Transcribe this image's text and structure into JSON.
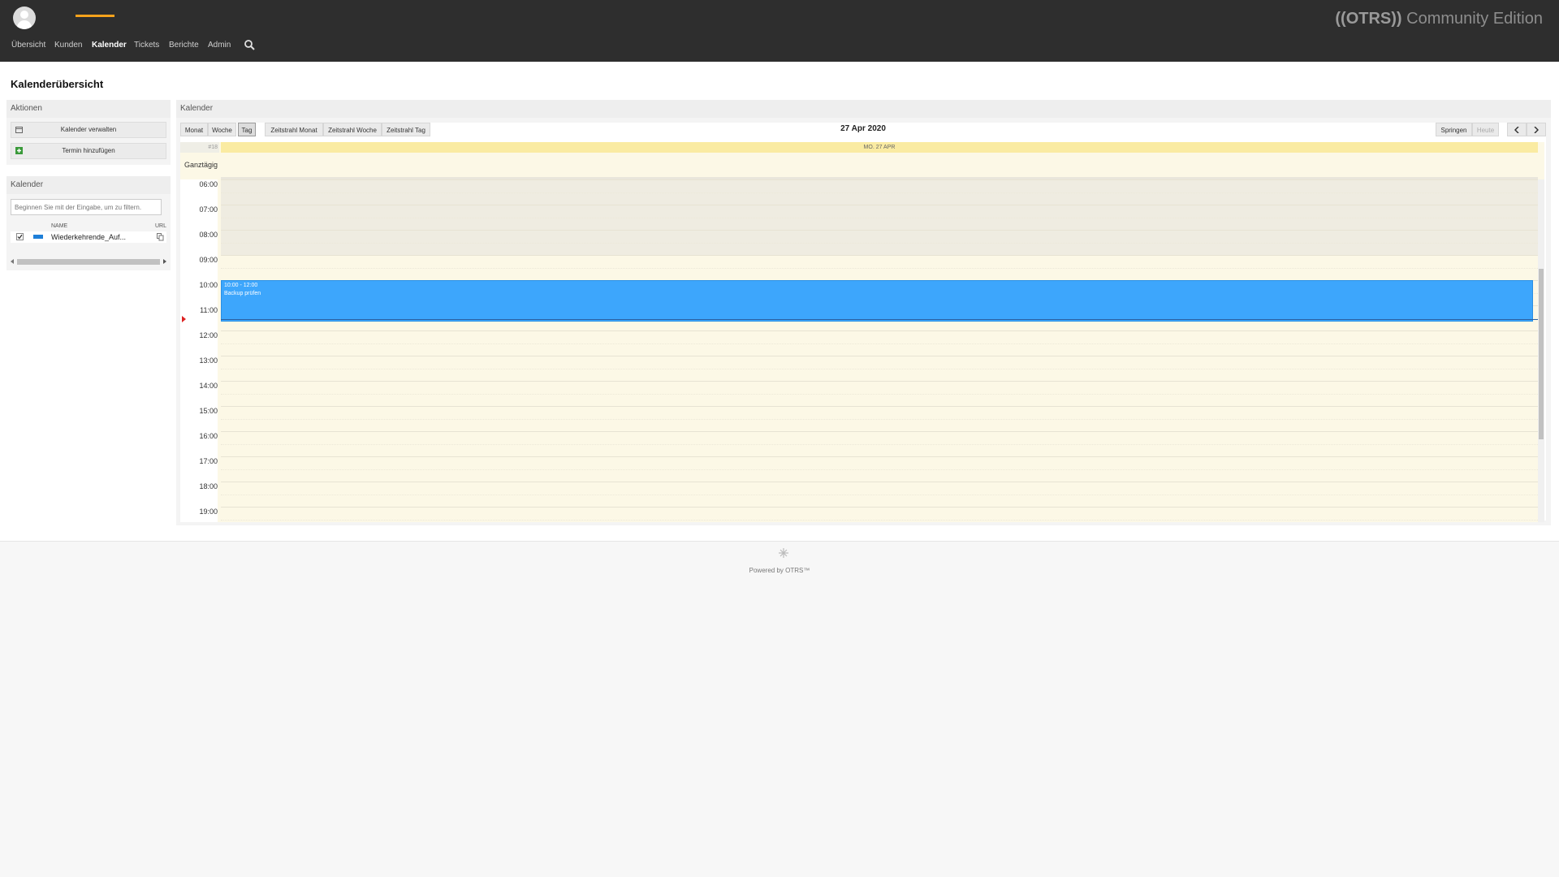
{
  "header": {
    "brand_prefix": "((OTRS))",
    "brand_suffix": " Community Edition",
    "nav": [
      {
        "label": "Übersicht"
      },
      {
        "label": "Kunden"
      },
      {
        "label": "Kalender",
        "active": true
      },
      {
        "label": "Tickets"
      },
      {
        "label": "Berichte"
      },
      {
        "label": "Admin"
      }
    ],
    "search_icon": "search-icon",
    "accent_color": "#f7a21c"
  },
  "page": {
    "title": "Kalenderübersicht"
  },
  "actions": {
    "title": "Aktionen",
    "items": [
      {
        "label": "Kalender verwalten",
        "icon": "calendar-icon"
      },
      {
        "label": "Termin hinzufügen",
        "icon": "add-icon"
      }
    ]
  },
  "calendars": {
    "title": "Kalender",
    "filter_placeholder": "Beginnen Sie mit der Eingabe, um zu filtern.",
    "columns": [
      "NAME",
      "URL"
    ],
    "rows": [
      {
        "name": "Wiederkehrende_Auf...",
        "checked": true,
        "color": "#1e7fd8"
      }
    ]
  },
  "calendar": {
    "title": "Kalender",
    "view_buttons": [
      "Monat",
      "Woche",
      "Tag",
      "Zeitstrahl Monat",
      "Zeitstrahl Woche",
      "Zeitstrahl Tag"
    ],
    "active_view": "Tag",
    "date_title": "27 Apr 2020",
    "jump_label": "Springen",
    "today_label": "Heute",
    "week_number": "#18",
    "day_header": "MO. 27 APR",
    "allday_label": "Ganztägig",
    "hours": [
      "06:00",
      "07:00",
      "08:00",
      "09:00",
      "10:00",
      "11:00",
      "12:00",
      "13:00",
      "14:00",
      "15:00",
      "16:00",
      "17:00",
      "18:00",
      "19:00"
    ],
    "event": {
      "time": "10:00 - 12:00",
      "title": "Backup prüfen",
      "color": "#3da6fc"
    }
  },
  "footer": {
    "text": "Powered by OTRS™"
  }
}
